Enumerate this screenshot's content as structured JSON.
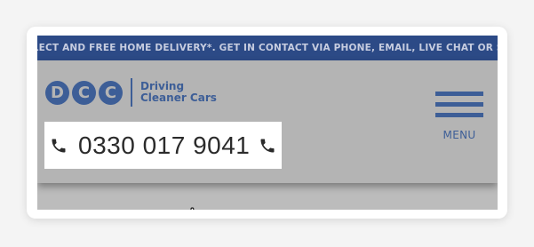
{
  "announcement": "COLLECT AND FREE HOME DELIVERY*. GET IN CONTACT VIA PHONE, EMAIL, LIVE CHAT OR SMS.",
  "logo": {
    "letters": [
      "D",
      "C",
      "C"
    ],
    "tagline_line1": "Driving",
    "tagline_line2": "Cleaner Cars"
  },
  "phone": {
    "number": "0330 017 9041",
    "icon": "phone-icon"
  },
  "menu": {
    "label": "MENU",
    "icon": "hamburger-icon"
  },
  "colors": {
    "brand_blue": "#3d5e97",
    "announcement_bar": "#2c4a86",
    "header_bg": "#b4b4b4"
  }
}
